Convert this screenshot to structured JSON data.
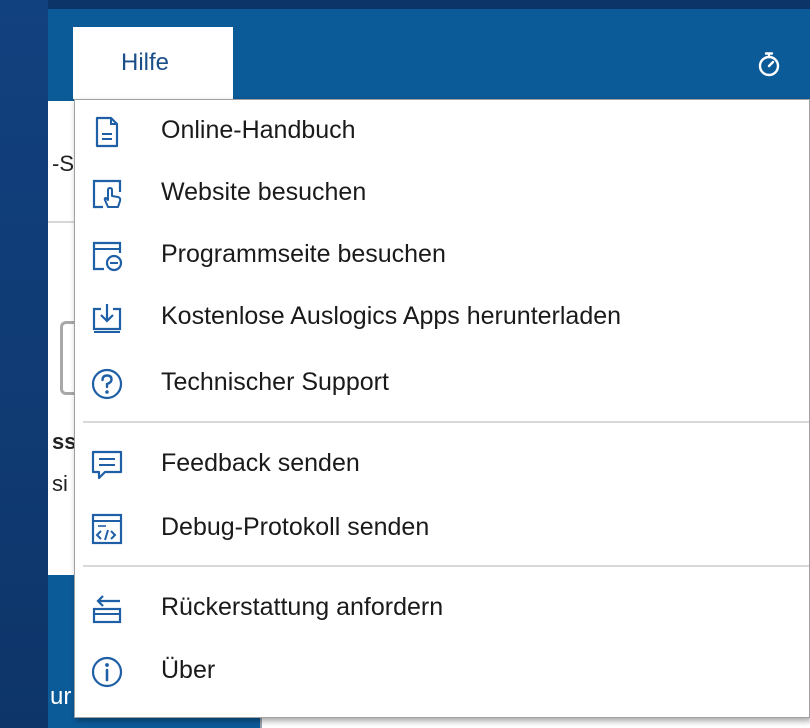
{
  "menubar": {
    "active_menu": "Hilfe"
  },
  "header_icons": [
    "stopwatch-icon"
  ],
  "background_fragments": {
    "top_text": "-S",
    "mid_text_1": "ss",
    "mid_text_2": "si",
    "bottom_text": "ur"
  },
  "menu": {
    "groups": [
      [
        {
          "icon": "document-icon",
          "label": "Online-Handbuch"
        },
        {
          "icon": "hand-click-icon",
          "label": "Website besuchen"
        },
        {
          "icon": "window-refresh-icon",
          "label": "Programmseite besuchen"
        },
        {
          "icon": "download-icon",
          "label": "Kostenlose Auslogics Apps herunterladen"
        },
        {
          "icon": "question-icon",
          "label": "Technischer Support"
        }
      ],
      [
        {
          "icon": "feedback-icon",
          "label": "Feedback senden"
        },
        {
          "icon": "debug-log-icon",
          "label": "Debug-Protokoll senden"
        }
      ],
      [
        {
          "icon": "refund-icon",
          "label": "Rückerstattung anfordern"
        },
        {
          "icon": "info-icon",
          "label": "Über"
        }
      ]
    ]
  },
  "colors": {
    "accent": "#0c5b99",
    "desktop": "#0f3a73",
    "icon_stroke": "#1e5fa6",
    "text": "#1a1a1a"
  }
}
